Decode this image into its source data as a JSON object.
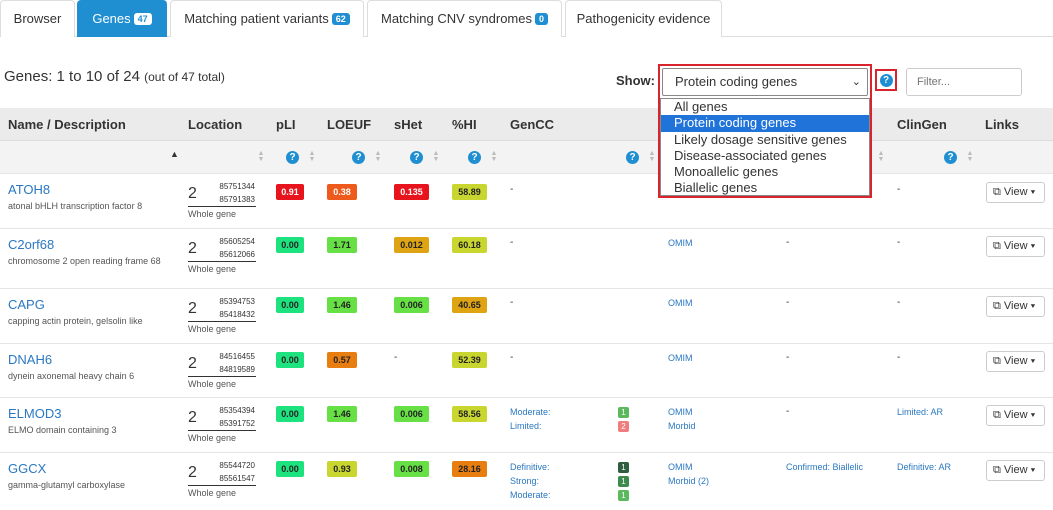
{
  "tabs": [
    {
      "label": "Browser",
      "badge": ""
    },
    {
      "label": "Genes",
      "badge": "47"
    },
    {
      "label": "Matching patient variants",
      "badge": "62"
    },
    {
      "label": "Matching CNV syndromes",
      "badge": "0"
    },
    {
      "label": "Pathogenicity evidence",
      "badge": ""
    }
  ],
  "summary": {
    "main": "Genes: 1 to 10 of 24",
    "sub": "(out of 47 total)"
  },
  "show": {
    "label": "Show:",
    "selected": "Protein coding genes",
    "chevron": "⌄",
    "options": [
      "All genes",
      "Protein coding genes",
      "Likely dosage sensitive genes",
      "Disease-associated genes",
      "Monoallelic genes",
      "Biallelic genes"
    ]
  },
  "help": "?",
  "filter": {
    "placeholder": "Filter..."
  },
  "columns": {
    "name": "Name / Description",
    "location": "Location",
    "pli": "pLI",
    "loeuf": "LOEUF",
    "shet": "sHet",
    "hi": "%HI",
    "gencc": "GenCC",
    "clingen": "ClinGen",
    "links": "Links"
  },
  "sort_indicator": "▲",
  "rows": [
    {
      "name": "ATOH8",
      "desc": "atonal bHLH transcription factor 8",
      "chr": "2",
      "start": "85751344",
      "end": "85791383",
      "region": "Whole gene",
      "pli": "0.91",
      "loeuf": "0.38",
      "shet": "0.135",
      "hi": "58.89",
      "gencc": "-",
      "omim": "",
      "gene2phen": "",
      "clingen": "-",
      "view": "View"
    },
    {
      "name": "C2orf68",
      "desc": "chromosome 2 open reading frame 68",
      "chr": "2",
      "start": "85605254",
      "end": "85612066",
      "region": "Whole gene",
      "pli": "0.00",
      "loeuf": "1.71",
      "shet": "0.012",
      "hi": "60.18",
      "gencc": "-",
      "omim": "OMIM",
      "gene2phen": "-",
      "clingen": "-",
      "view": "View"
    },
    {
      "name": "CAPG",
      "desc": "capping actin protein, gelsolin like",
      "chr": "2",
      "start": "85394753",
      "end": "85418432",
      "region": "Whole gene",
      "pli": "0.00",
      "loeuf": "1.46",
      "shet": "0.006",
      "hi": "40.65",
      "gencc": "-",
      "omim": "OMIM",
      "gene2phen": "-",
      "clingen": "-",
      "view": "View"
    },
    {
      "name": "DNAH6",
      "desc": "dynein axonemal heavy chain 6",
      "chr": "2",
      "start": "84516455",
      "end": "84819589",
      "region": "Whole gene",
      "pli": "0.00",
      "loeuf": "0.57",
      "shet": "-",
      "hi": "52.39",
      "gencc": "-",
      "omim": "OMIM",
      "gene2phen": "-",
      "clingen": "-",
      "view": "View"
    },
    {
      "name": "ELMOD3",
      "desc": "ELMO domain containing 3",
      "chr": "2",
      "start": "85354394",
      "end": "85391752",
      "region": "Whole gene",
      "pli": "0.00",
      "loeuf": "1.46",
      "shet": "0.006",
      "hi": "58.56",
      "gencc_lines": [
        "Moderate:",
        "Limited:"
      ],
      "gencc_counts": [
        "1",
        "2"
      ],
      "omim_lines": [
        "OMIM",
        "Morbid"
      ],
      "gene2phen": "-",
      "clingen": "Limited: AR",
      "view": "View"
    },
    {
      "name": "GGCX",
      "desc": "gamma-glutamyl carboxylase",
      "chr": "2",
      "start": "85544720",
      "end": "85561547",
      "region": "Whole gene",
      "pli": "0.00",
      "loeuf": "0.93",
      "shet": "0.008",
      "hi": "28.16",
      "gencc_lines": [
        "Definitive:",
        "Strong:",
        "Moderate:"
      ],
      "gencc_counts": [
        "1",
        "1",
        "1"
      ],
      "omim_lines": [
        "OMIM",
        "Morbid (2)"
      ],
      "gene2phen": "Confirmed: Biallelic",
      "clingen": "Definitive: AR",
      "view": "View"
    }
  ],
  "colors": {
    "red": "#e8141d",
    "orange": "#ee5a1c",
    "darkorange": "#e87e10",
    "amber": "#dfa414",
    "yellowgreen": "#c9d630",
    "green": "#66e045",
    "brightgreen": "#1de37f"
  }
}
